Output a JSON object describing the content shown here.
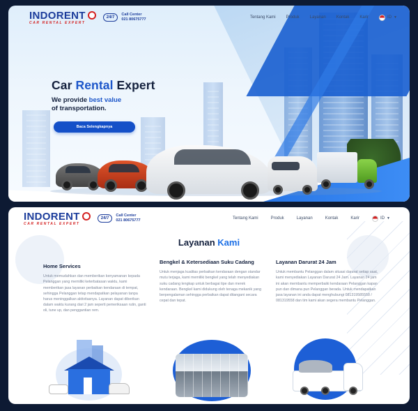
{
  "header": {
    "logo": "INDORENT",
    "tagline": "CAR RENTAL EXPERT",
    "badge_247": "24/7",
    "call_label": "Call Center",
    "call_number": "021 80675777"
  },
  "nav": {
    "items": [
      "Tentang Kami",
      "Produk",
      "Layanan",
      "Kontak",
      "Karir"
    ],
    "language": "ID"
  },
  "hero": {
    "title_pre": "Car ",
    "title_accent": "Rental",
    "title_post": " Expert",
    "sub_pre": "We provide ",
    "sub_accent": "best value",
    "sub_line2": "of transportation.",
    "cta_label": "Baca Selengkapnya"
  },
  "services": {
    "title_pre": "Layanan ",
    "title_accent": "Kami",
    "items": [
      {
        "title": "Home Services",
        "text": "Untuk memudahkan dan memberikan kenyamanan kepada Pelanggan yang memiliki keterbatasan waktu, kami memberikan jasa layanan perbaikan kendaraan di tempat, sehingga Pelanggan tetap mendapatkan pelayanan tanpa harus meninggalkan aktivitasnya. Layanan dapat diberikan dalam waktu kurang dari 2 jam seperti pemeriksaan rutin, ganti oli, tune up, dan penggantian rem."
      },
      {
        "title": "Bengkel & Ketersediaan Suku Cadang",
        "text": "Untuk menjaga kualitas perbaikan kendaraan dengan standar mutu terjaga, kami memiliki bengkel yang telah menyediakan suku cadang lengkap untuk berbagai tipe dan merek kendaraan. Bengkel kami didukung oleh tenaga mekanik yang berpengalaman sehingga perbaikan dapat ditangani secara cepat dan tepat."
      },
      {
        "title": "Layanan Darurat 24 Jam",
        "text": "Untuk membantu Pelanggan dalam situasi darurat setiap saat, kami menyediakan Layanan Darurat 24 Jam. Layanan 24 jam ini akan membantu memperbaiki kendaraan Pelanggan kapan pun dan dimana pun Pelanggan berada. Untuk mendapatkan jasa layanan ini anda dapat menghubungi 081319585558 / 081319558 dan tim kami akan segera membantu Pelanggan."
      }
    ]
  },
  "colors": {
    "brand_blue": "#1b3c9b",
    "accent_blue": "#1b55c9",
    "brand_red": "#d42020",
    "page_bg": "#0d1a33"
  }
}
